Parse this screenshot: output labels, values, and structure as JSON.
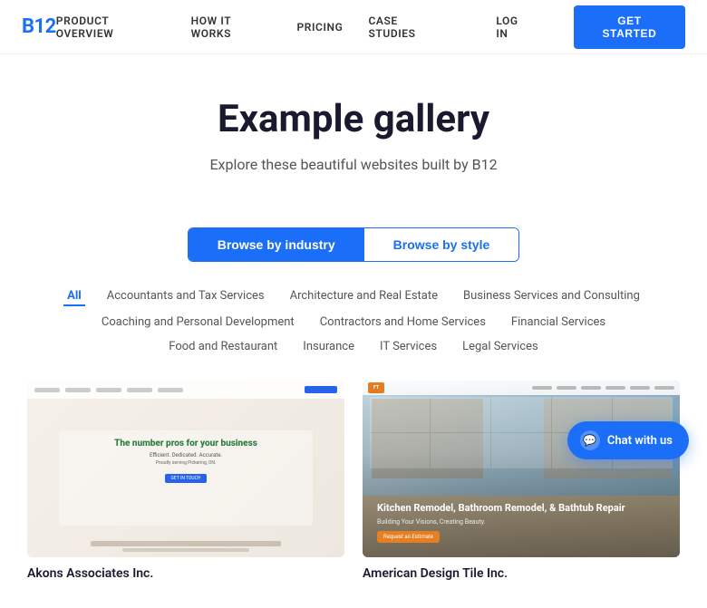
{
  "brand": {
    "logo": "B12",
    "logo_color": "#1a6ef7"
  },
  "nav": {
    "links": [
      {
        "id": "product-overview",
        "label": "PRODUCT OVERVIEW"
      },
      {
        "id": "how-it-works",
        "label": "HOW IT WORKS"
      },
      {
        "id": "pricing",
        "label": "PRICING"
      },
      {
        "id": "case-studies",
        "label": "CASE STUDIES"
      }
    ],
    "login_label": "LOG IN",
    "cta_label": "GET STARTED"
  },
  "hero": {
    "title": "Example gallery",
    "subtitle": "Explore these beautiful websites built by B12"
  },
  "tabs": [
    {
      "id": "industry",
      "label": "Browse by industry",
      "active": true
    },
    {
      "id": "style",
      "label": "Browse by style",
      "active": false
    }
  ],
  "filters": [
    {
      "id": "all",
      "label": "All",
      "active": true
    },
    {
      "id": "accountants",
      "label": "Accountants and Tax Services",
      "active": false
    },
    {
      "id": "architecture",
      "label": "Architecture and Real Estate",
      "active": false
    },
    {
      "id": "business",
      "label": "Business Services and Consulting",
      "active": false
    },
    {
      "id": "coaching",
      "label": "Coaching and Personal Development",
      "active": false
    },
    {
      "id": "contractors",
      "label": "Contractors and Home Services",
      "active": false
    },
    {
      "id": "financial",
      "label": "Financial Services",
      "active": false
    },
    {
      "id": "food",
      "label": "Food and Restaurant",
      "active": false
    },
    {
      "id": "insurance",
      "label": "Insurance",
      "active": false
    },
    {
      "id": "it",
      "label": "IT Services",
      "active": false
    },
    {
      "id": "legal",
      "label": "Legal Services",
      "active": false
    }
  ],
  "gallery": {
    "cards": [
      {
        "id": "card-1",
        "title": "Akons Associates Inc.",
        "headline": "The number pros for your business",
        "subline": "Efficient. Dedicated. Accurate.",
        "tagline": "Proudly serving Pickering, ON.",
        "btn_label": "GET IN TOUCH",
        "accent_color": "#1a8a3a"
      },
      {
        "id": "card-2",
        "title": "American Design Tile Inc.",
        "headline": "Kitchen Remodel, Bathroom Remodel, & Bathtub Repair",
        "subline": "Building Your Visions, Creating Beauty.",
        "btn_label": "Request an Estimate"
      }
    ]
  },
  "chat_widget": {
    "label": "Chat with us",
    "icon": "💬"
  }
}
